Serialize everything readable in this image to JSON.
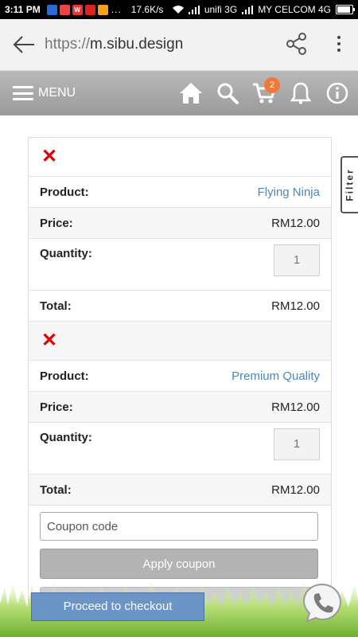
{
  "status_bar": {
    "time": "3:11 PM",
    "dots": "...",
    "speed": "17.6K/s",
    "carrier1": "unifi 3G",
    "carrier2": "MY CELCOM 4G"
  },
  "browser": {
    "url_scheme": "https://",
    "url_host": "m.sibu.design"
  },
  "header": {
    "menu_label": "MENU",
    "cart_count": "2"
  },
  "filter_label": "Filter",
  "cart": {
    "remove_symbol": "✕",
    "labels": {
      "product": "Product:",
      "price": "Price:",
      "quantity": "Quantity:",
      "total": "Total:"
    },
    "items": [
      {
        "product": "Flying Ninja",
        "price": "RM12.00",
        "quantity": "1",
        "total": "RM12.00"
      },
      {
        "product": "Premium Quality",
        "price": "RM12.00",
        "quantity": "1",
        "total": "RM12.00"
      }
    ],
    "coupon_placeholder": "Coupon code",
    "apply_coupon_label": "Apply coupon",
    "checkout_label": "Proceed to checkout"
  },
  "colors": {
    "link": "#4a86b8",
    "remove": "#e00000",
    "badge": "#f07a3a",
    "checkout": "#6b94c7"
  }
}
